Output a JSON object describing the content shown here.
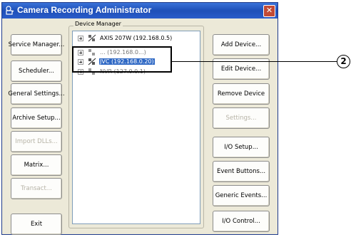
{
  "window": {
    "title": "Camera Recording Administrator",
    "close_glyph": "✕"
  },
  "left_buttons": [
    {
      "label": "Service Manager...",
      "enabled": true
    },
    {
      "label": "Scheduler...",
      "enabled": true
    },
    {
      "label": "General Settings...",
      "enabled": true
    },
    {
      "label": "Archive Setup...",
      "enabled": true
    },
    {
      "label": "Import DLLs...",
      "enabled": false
    },
    {
      "label": "Matrix...",
      "enabled": true
    },
    {
      "label": "Transact...",
      "enabled": false
    },
    {
      "label": "Exit",
      "enabled": true
    }
  ],
  "device_manager": {
    "label": "Device Manager",
    "devices": [
      {
        "label": "AXIS 207W (192.168.0.5)",
        "state": "normal"
      },
      {
        "label": "... (192.168.0...)",
        "state": "faint"
      },
      {
        "label": "JVC (192.168.0.20)",
        "state": "selected"
      },
      {
        "label": "NVR (127.0.0.1)",
        "state": "faint"
      }
    ]
  },
  "right_buttons": [
    {
      "label": "Add Device...",
      "enabled": true
    },
    {
      "label": "Edit Device...",
      "enabled": true
    },
    {
      "label": "Remove Device",
      "enabled": true
    },
    {
      "label": "Settings...",
      "enabled": false
    },
    {
      "label": "I/O Setup...",
      "enabled": true
    },
    {
      "label": "Event Buttons...",
      "enabled": true
    },
    {
      "label": "Generic Events...",
      "enabled": true
    },
    {
      "label": "I/O Control...",
      "enabled": true
    }
  ],
  "callout": {
    "number": "2"
  },
  "icons": {
    "app": "camera-icon",
    "device": "device-camera-icon",
    "close": "close-icon"
  }
}
